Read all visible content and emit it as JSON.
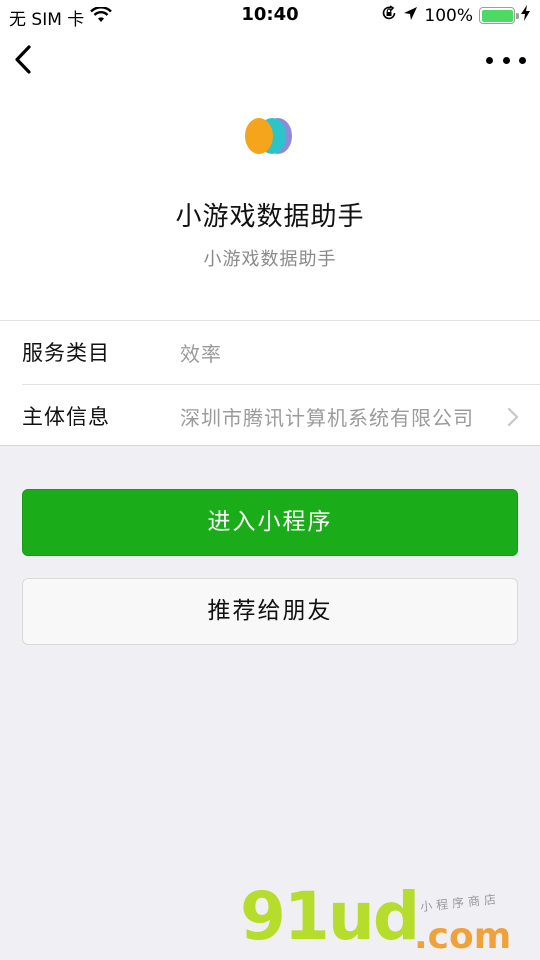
{
  "status_bar": {
    "carrier": "无 SIM 卡",
    "time": "10:40",
    "battery_percent": "100%",
    "battery_level": 1.0,
    "wifi_icon": "wifi-icon",
    "lock_icon": "orientation-lock-icon",
    "location_icon": "location-arrow-icon",
    "charging_icon": "charging-bolt-icon"
  },
  "nav": {
    "back_icon": "chevron-left-icon",
    "more_icon": "more-dots-icon"
  },
  "app": {
    "name": "小游戏数据助手",
    "description": "小游戏数据助手",
    "logo_colors": [
      "#f4a51c",
      "#2bc5c9",
      "#8f8bd8"
    ]
  },
  "info": {
    "rows": [
      {
        "label": "服务类目",
        "value": "效率",
        "has_chevron": false
      },
      {
        "label": "主体信息",
        "value": "深圳市腾讯计算机系统有限公司",
        "has_chevron": true
      }
    ]
  },
  "actions": {
    "enter_label": "进入小程序",
    "share_label": "推荐给朋友"
  },
  "colors": {
    "primary_green": "#1aad19",
    "background": "#efeff4"
  },
  "watermark": {
    "main": "91ud",
    "domain": ".com",
    "subtitle": "小程序商店"
  }
}
